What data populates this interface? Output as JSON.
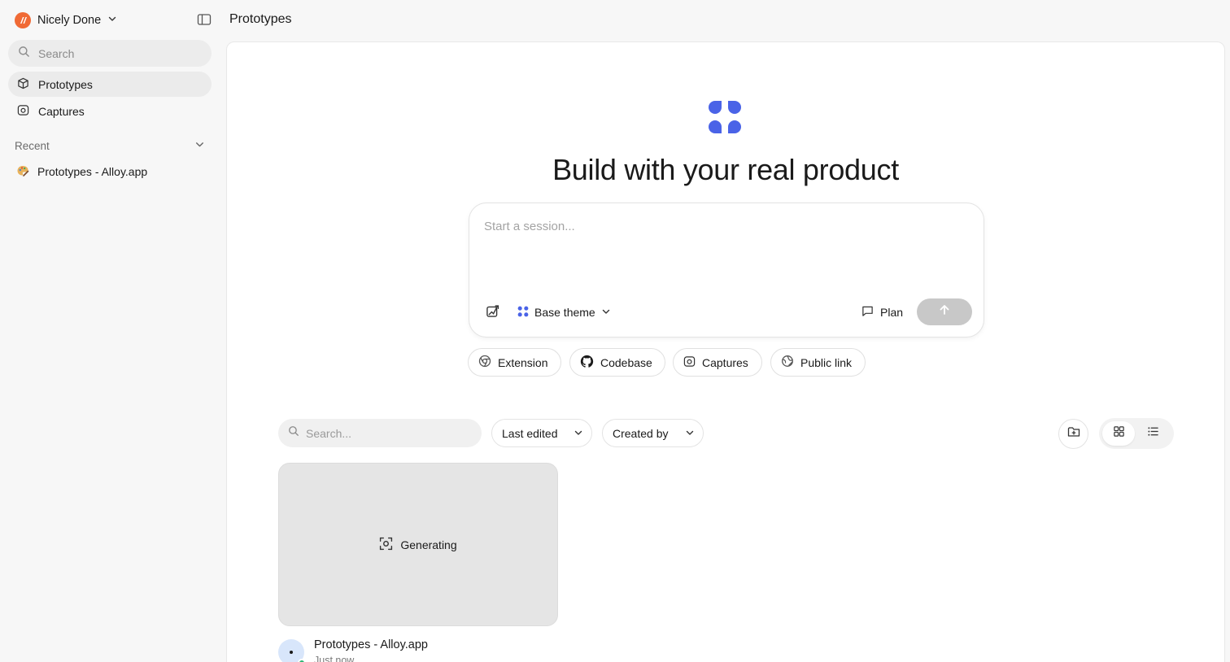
{
  "sidebar": {
    "workspace_name": "Nicely Done",
    "search_placeholder": "Search",
    "nav": [
      {
        "label": "Prototypes",
        "icon": "cube-icon",
        "active": true
      },
      {
        "label": "Captures",
        "icon": "camera-icon",
        "active": false
      }
    ],
    "recent_label": "Recent",
    "recent_items": [
      {
        "label": "Prototypes - Alloy.app",
        "icon": "palette-icon"
      }
    ]
  },
  "header": {
    "title": "Prototypes"
  },
  "hero": {
    "title": "Build with your real product"
  },
  "composer": {
    "placeholder": "Start a session...",
    "theme_label": "Base theme",
    "plan_label": "Plan"
  },
  "chips": [
    {
      "label": "Extension",
      "icon": "chrome-icon"
    },
    {
      "label": "Codebase",
      "icon": "github-icon"
    },
    {
      "label": "Captures",
      "icon": "camera-icon"
    },
    {
      "label": "Public link",
      "icon": "globe-link-icon"
    }
  ],
  "list": {
    "search_placeholder": "Search...",
    "sort_label": "Last edited",
    "filter_label": "Created by",
    "view_mode": "grid"
  },
  "cards": [
    {
      "status": "Generating",
      "title": "Prototypes - Alloy.app",
      "time": "Just now"
    }
  ],
  "colors": {
    "accent": "#4a63e7",
    "workspace_logo": "#f06a35",
    "online": "#2bb673"
  }
}
